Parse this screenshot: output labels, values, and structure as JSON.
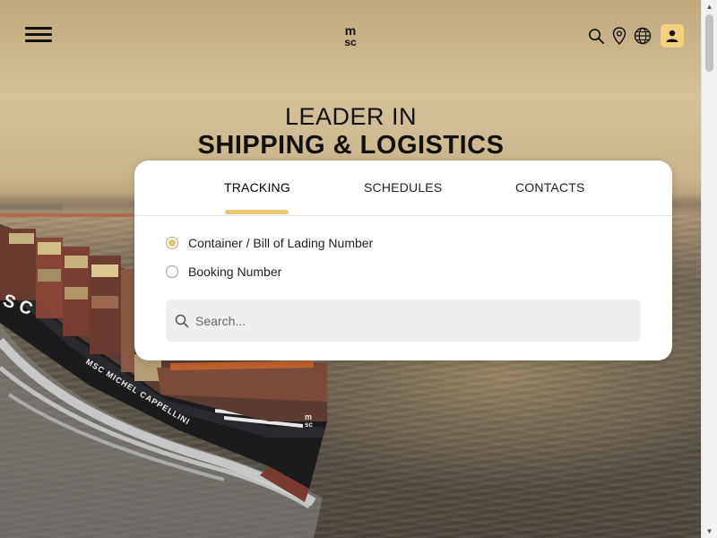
{
  "header": {
    "menu_icon": "hamburger-menu-icon",
    "logo_text_top": "m",
    "logo_text_bottom": "sc",
    "icons": [
      "search-icon",
      "location-pin-icon",
      "globe-icon",
      "user-icon"
    ]
  },
  "hero": {
    "line1": "LEADER IN",
    "line2": "SHIPPING & LOGISTICS",
    "ship_hull_text": "MSC MICHEL CAPPELLINI",
    "ship_side_letters": "S C"
  },
  "tracking": {
    "tabs": [
      {
        "label": "TRACKING",
        "active": true
      },
      {
        "label": "SCHEDULES",
        "active": false
      },
      {
        "label": "CONTACTS",
        "active": false
      }
    ],
    "options": [
      {
        "label": "Container / Bill of Lading Number",
        "checked": true
      },
      {
        "label": "Booking Number",
        "checked": false
      }
    ],
    "search": {
      "placeholder": "Search...",
      "value": ""
    }
  },
  "colors": {
    "accent": "#e9c874",
    "user_button": "#f2d27d",
    "text": "#111111",
    "card_bg": "#ffffff",
    "search_bg": "#efefef"
  }
}
